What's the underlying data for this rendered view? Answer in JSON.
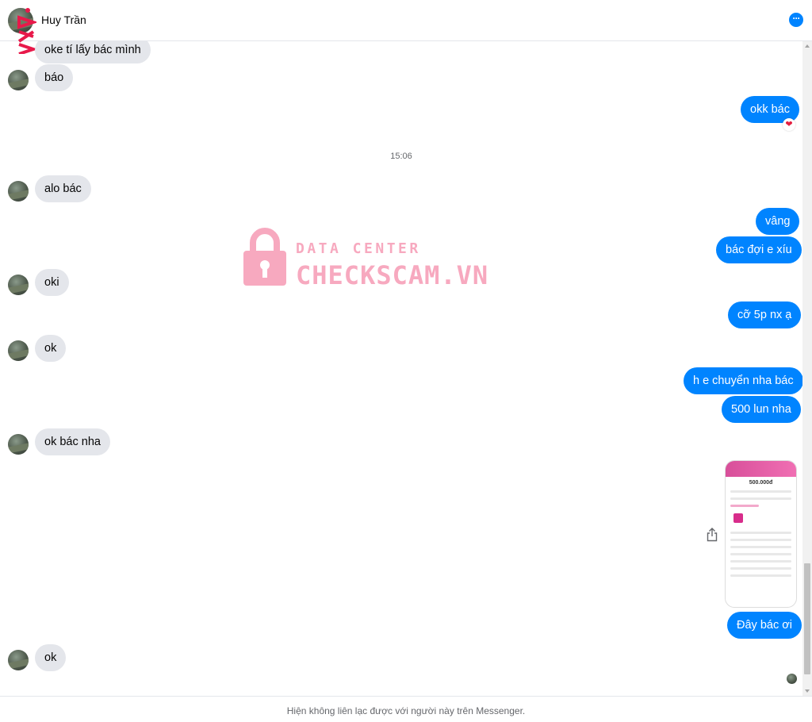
{
  "header": {
    "contact_name": "Huy Trần",
    "more_icon": "more-options-icon"
  },
  "accent_color": "#0084ff",
  "watermark": {
    "line1": "DATA CENTER",
    "line2": "CHECKSCAM.VN"
  },
  "messages": [
    {
      "from": "them",
      "text": "oke tí lấy bác mình"
    },
    {
      "from": "them",
      "text": "báo"
    },
    {
      "from": "me",
      "text": "okk bác",
      "reaction": "❤"
    },
    {
      "from": "system",
      "text": "15:06"
    },
    {
      "from": "them",
      "text": "alo bác"
    },
    {
      "from": "me",
      "text": "vâng"
    },
    {
      "from": "me",
      "text": "bác đợi e xíu"
    },
    {
      "from": "them",
      "text": "oki"
    },
    {
      "from": "me",
      "text": "cỡ 5p nx ạ"
    },
    {
      "from": "them",
      "text": "ok"
    },
    {
      "from": "me",
      "text": "h e chuyển nha bác"
    },
    {
      "from": "me",
      "text": "500 lun nha"
    },
    {
      "from": "them",
      "text": "ok bác nha"
    },
    {
      "from": "me",
      "type": "image",
      "image_desc": "payment-receipt-screenshot",
      "amount": "500.000đ"
    },
    {
      "from": "me",
      "text": "Đây bác ơi"
    },
    {
      "from": "them",
      "text": "ok"
    }
  ],
  "footer": {
    "notice": "Hiện không liên lạc được với người này trên Messenger."
  }
}
